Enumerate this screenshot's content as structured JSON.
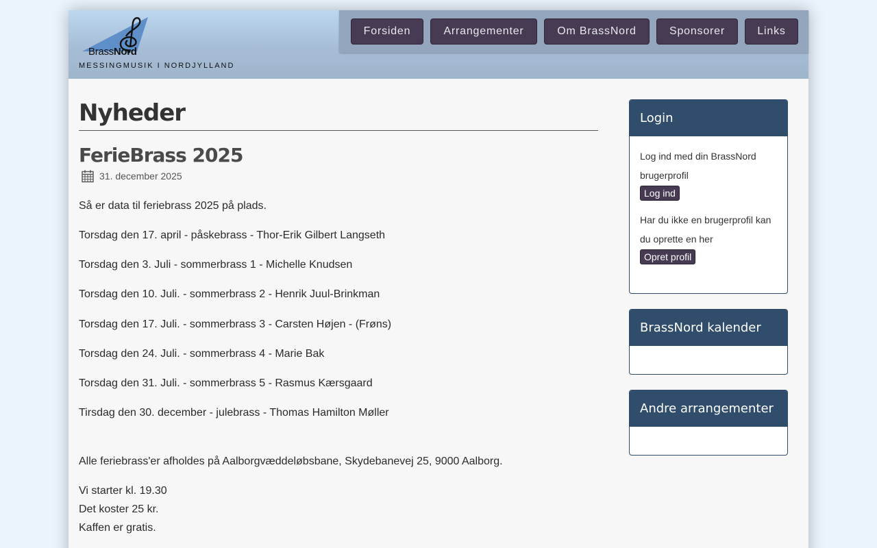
{
  "header": {
    "logo_brass": "Brass",
    "logo_nord": "Nord",
    "tagline": "MESSINGMUSIK I NORDJYLLAND"
  },
  "nav": {
    "items": [
      {
        "label": "Forsiden"
      },
      {
        "label": "Arrangementer"
      },
      {
        "label": "Om BrassNord"
      },
      {
        "label": "Sponsorer"
      },
      {
        "label": "Links"
      }
    ]
  },
  "main": {
    "page_title": "Nyheder",
    "post": {
      "title": "FerieBrass 2025",
      "date": "31. december 2025",
      "intro": "Så er data til feriebrass 2025 på plads.",
      "events": [
        "Torsdag den 17. april - påskebrass - Thor-Erik Gilbert Langseth",
        "Torsdag den 3. Juli - sommerbrass 1 - Michelle Knudsen",
        "Torsdag den 10. Juli. - sommerbrass 2 - Henrik Juul-Brinkman",
        "Torsdag den 17. Juli. - sommerbrass 3 - Carsten Højen - (Frøns)",
        "Torsdag den 24. Juli. - sommerbrass 4 - Marie Bak",
        "Torsdag den 31. Juli. - sommerbrass 5 - Rasmus Kærsgaard",
        "Tirsdag den 30. december - julebrass - Thomas Hamilton Møller"
      ],
      "location": "Alle feriebrass'er afholdes på Aalborgvæddeløbsbane, Skydebanevej 25, 9000 Aalborg.",
      "start_time": "Vi starter kl. 19.30",
      "price": "Det koster 25 kr.",
      "coffee": "Kaffen er gratis."
    }
  },
  "sidebar": {
    "login": {
      "heading": "Login",
      "text1": "Log ind med din BrassNord brugerprofil",
      "login_button": "Log ind",
      "text2": "Har du ikke en brugerprofil kan du oprette en her",
      "create_button": "Opret profil"
    },
    "calendar": {
      "heading": "BrassNord kalender"
    },
    "other_events": {
      "heading": "Andre arrangementer"
    }
  },
  "colors": {
    "nav_button": "#463b52",
    "panel_header": "#304d6b",
    "background": "#eaf4fd"
  }
}
